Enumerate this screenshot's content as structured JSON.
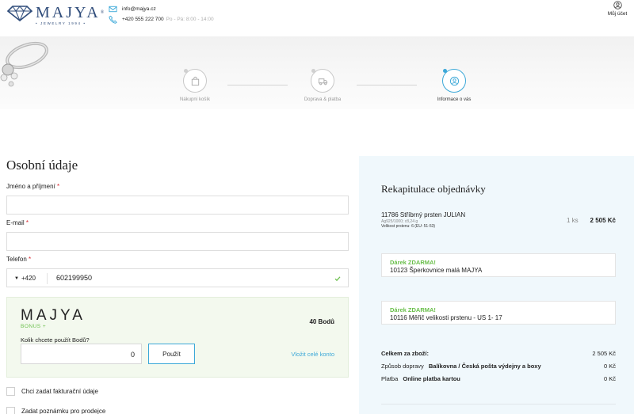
{
  "brand": {
    "name": "MAJYA",
    "reg_mark": "®",
    "tagline": "• JEWELRY 1994 •"
  },
  "contact": {
    "email": "info@majya.cz",
    "phone": "+420 555 222 700",
    "hours": "Po - Pá: 8:00 - 14:00"
  },
  "account": {
    "label": "Můj účet"
  },
  "steps": [
    {
      "label": "Nákupní košík",
      "icon": "bag-icon",
      "active": false
    },
    {
      "label": "Doprava & platba",
      "icon": "truck-icon",
      "active": false
    },
    {
      "label": "Informace o vás",
      "icon": "user-icon",
      "active": true
    }
  ],
  "personal": {
    "title": "Osobní údaje",
    "name_label": "Jméno a příjmení",
    "email_label": "E-mail",
    "phone_label": "Telefon",
    "required_mark": "*",
    "phone_prefix": "+420",
    "phone_caret": "▼",
    "phone_value": "602199950"
  },
  "bonus": {
    "logo": "MAJYA",
    "subtitle": "BONUS +",
    "points": "40 Bodů",
    "question": "Kolik chcete použít Bodů?",
    "input_value": "0",
    "apply_button": "Použít",
    "use_all_link": "Vložit celé konto"
  },
  "options": {
    "invoice": "Chci zadat fakturační údaje",
    "note": "Zadat poznámku pro prodejce"
  },
  "recap": {
    "title": "Rekapitulace objednávky",
    "product": {
      "name": "11786 Stříbrný prsten JULIAN",
      "meta_line1": "Ag925/1000; c8,24 g",
      "meta_line2": "Velikost prstenu: 6 (EU: 51-53)",
      "qty": "1 ks",
      "price": "2 505 Kč"
    },
    "gifts": [
      {
        "tag": "Dárek ZDARMA!",
        "name": "10123 Šperkovnice malá MAJYA"
      },
      {
        "tag": "Dárek ZDARMA!",
        "name": "10116 Měřič velikosti prstenu - US 1- 17"
      }
    ],
    "total_label": "Celkem za zboží:",
    "total_value": "2 505 Kč",
    "shipping_label": "Způsob dopravy",
    "shipping_name": "Balíkovna / Česká pošta výdejny a boxy",
    "shipping_value": "0 Kč",
    "payment_label": "Platba",
    "payment_name": "Online platba kartou",
    "payment_value": "0 Kč"
  },
  "colors": {
    "brand": "#2f4c7a",
    "accent": "#3ba8d8",
    "green": "#6abf4b",
    "required": "#d9262e"
  }
}
